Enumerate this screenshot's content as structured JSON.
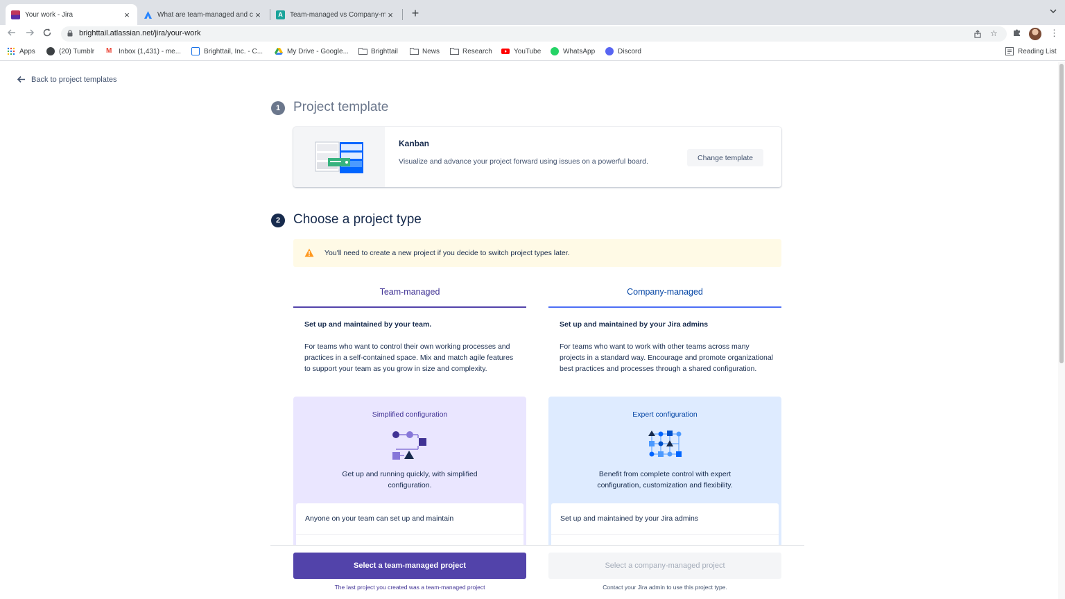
{
  "browser": {
    "tabs": [
      {
        "title": "Your work - Jira",
        "close": "×"
      },
      {
        "title": "What are team-managed and c",
        "close": "×"
      },
      {
        "title": "Team-managed vs Company-m",
        "close": "×"
      }
    ],
    "new_tab": "+",
    "url": "brighttail.atlassian.net/jira/your-work",
    "bookmarks": [
      {
        "label": "Apps",
        "icon": "apps-grid-icon"
      },
      {
        "label": "(20) Tumblr",
        "icon": "tumblr-icon"
      },
      {
        "label": "Inbox (1,431) - me...",
        "icon": "gmail-icon"
      },
      {
        "label": "Brighttail, Inc. - C...",
        "icon": "calendar-icon"
      },
      {
        "label": "My Drive - Google...",
        "icon": "google-drive-icon"
      },
      {
        "label": "Brighttail",
        "icon": "folder-icon"
      },
      {
        "label": "News",
        "icon": "folder-icon"
      },
      {
        "label": "Research",
        "icon": "folder-icon"
      },
      {
        "label": "YouTube",
        "icon": "youtube-icon"
      },
      {
        "label": "WhatsApp",
        "icon": "whatsapp-icon"
      },
      {
        "label": "Discord",
        "icon": "discord-icon"
      }
    ],
    "reading_list": "Reading List"
  },
  "page": {
    "back_link": "Back to project templates",
    "step1": {
      "number": "1",
      "title": "Project template"
    },
    "template": {
      "name": "Kanban",
      "description": "Visualize and advance your project forward using issues on a powerful board.",
      "change_button": "Change template"
    },
    "step2": {
      "number": "2",
      "title": "Choose a project type"
    },
    "warning": "You'll need to create a new project if you decide to switch project types later.",
    "team_managed": {
      "tab": "Team-managed",
      "heading": "Set up and maintained by your team.",
      "body": "For teams who want to control their own working processes and practices in a self-contained space. Mix and match agile features to support your team as you grow in size and complexity.",
      "config_title": "Simplified configuration",
      "config_desc": "Get up and running quickly, with simplified configuration.",
      "feature_1": "Anyone on your team can set up and maintain",
      "button": "Select a team-managed project",
      "note": "The last project you created was a team-managed project"
    },
    "company_managed": {
      "tab": "Company-managed",
      "heading": "Set up and maintained by your Jira admins",
      "body": "For teams who want to work with other teams across many projects in a standard way. Encourage and promote organizational best practices and processes through a shared configuration.",
      "config_title": "Expert configuration",
      "config_desc": "Benefit from complete control with expert configuration, customization and flexibility.",
      "feature_1": "Set up and maintained by your Jira admins",
      "button": "Select a company-managed project",
      "note": "Contact your Jira admin to use this project type."
    }
  },
  "colors": {
    "primary_purple": "#5243aa",
    "company_blue": "#0052cc",
    "team_config_bg": "#eae6ff",
    "company_config_bg": "#deebff",
    "warning_bg": "#fffae6",
    "warning_icon": "#ff991f"
  }
}
